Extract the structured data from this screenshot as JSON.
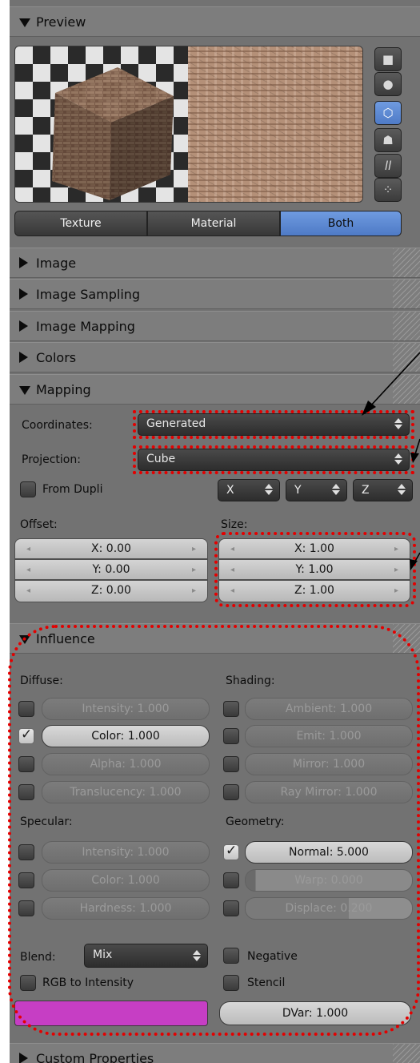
{
  "panels": {
    "preview": "Preview",
    "image": "Image",
    "image_sampling": "Image Sampling",
    "image_mapping": "Image Mapping",
    "colors": "Colors",
    "mapping": "Mapping",
    "influence": "Influence",
    "custom_properties": "Custom Properties"
  },
  "preview_tabs": {
    "texture": "Texture",
    "material": "Material",
    "both": "Both",
    "active": "Both"
  },
  "preview_shapes": [
    "flat-plane-icon",
    "sphere-icon",
    "cube-icon",
    "monkey-icon",
    "hair-icon",
    "sphere-cluster-icon"
  ],
  "preview_shapes_active": "cube-icon",
  "mapping": {
    "coordinates_label": "Coordinates:",
    "coordinates_value": "Generated",
    "projection_label": "Projection:",
    "projection_value": "Cube",
    "from_dupli_label": "From Dupli",
    "axes": [
      "X",
      "Y",
      "Z"
    ],
    "offset_label": "Offset:",
    "size_label": "Size:",
    "offset": [
      "X: 0.00",
      "Y: 0.00",
      "Z: 0.00"
    ],
    "size": [
      "X: 1.00",
      "Y: 1.00",
      "Z: 1.00"
    ]
  },
  "influence": {
    "diffuse_label": "Diffuse:",
    "shading_label": "Shading:",
    "specular_label": "Specular:",
    "geometry_label": "Geometry:",
    "diffuse": [
      {
        "label": "Intensity: 1.000",
        "checked": false
      },
      {
        "label": "Color: 1.000",
        "checked": true
      },
      {
        "label": "Alpha: 1.000",
        "checked": false
      },
      {
        "label": "Translucency: 1.000",
        "checked": false
      }
    ],
    "shading": [
      {
        "label": "Ambient: 1.000",
        "checked": false
      },
      {
        "label": "Emit: 1.000",
        "checked": false
      },
      {
        "label": "Mirror: 1.000",
        "checked": false
      },
      {
        "label": "Ray Mirror: 1.000",
        "checked": false
      }
    ],
    "specular": [
      {
        "label": "Intensity: 1.000",
        "checked": false
      },
      {
        "label": "Color: 1.000",
        "checked": false
      },
      {
        "label": "Hardness: 1.000",
        "checked": false
      }
    ],
    "geometry": [
      {
        "label": "Normal: 5.000",
        "checked": true
      },
      {
        "label": "Warp: 0.000",
        "checked": false
      },
      {
        "label": "Displace: 0.200",
        "checked": false
      }
    ],
    "blend_label": "Blend:",
    "blend_value": "Mix",
    "negative_label": "Negative",
    "rgb_to_intensity_label": "RGB to Intensity",
    "stencil_label": "Stencil",
    "dvar_label": "DVar: 1.000",
    "color_swatch": "#c63ec4"
  },
  "colors": {
    "panel": "#727272",
    "header": "#7d7d7d",
    "active_blue": "#5b88d4",
    "annotation_red": "#e30000"
  }
}
